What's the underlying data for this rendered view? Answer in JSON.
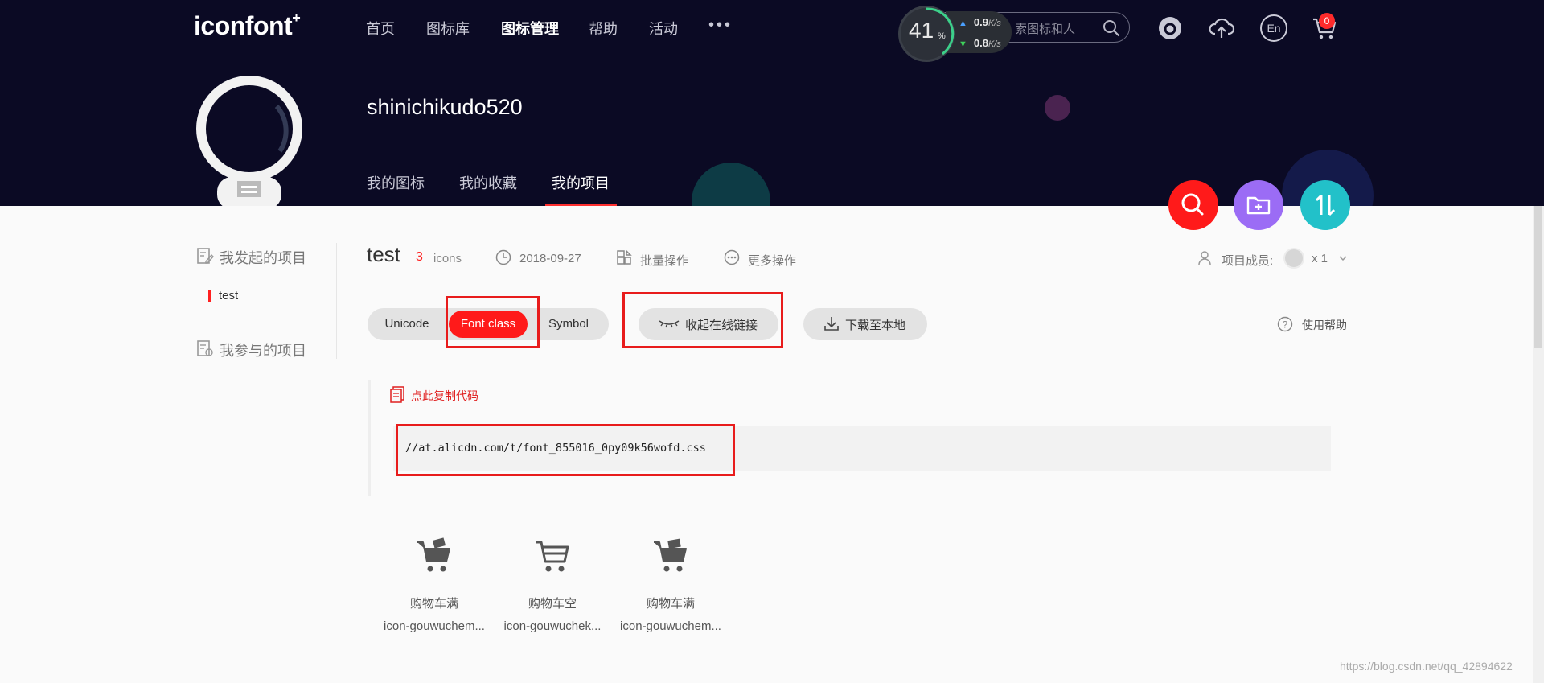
{
  "header": {
    "logo": "iconfont",
    "logo_plus": "+",
    "nav": [
      "首页",
      "图标库",
      "图标管理",
      "帮助",
      "活动"
    ],
    "nav_active_index": 2,
    "more": "•••",
    "search_placeholder": "索图标和人",
    "cart_count": "0",
    "icons": [
      "github-icon",
      "upload-cloud-icon",
      "language-en-icon",
      "cart-icon"
    ],
    "lang_label": "En"
  },
  "speed_widget": {
    "percent": "41",
    "percent_sign": "%",
    "upload": "0.9",
    "download": "0.8",
    "unit": "K/s"
  },
  "profile": {
    "username": "shinichikudo520",
    "tabs": [
      "我的图标",
      "我的收藏",
      "我的项目"
    ],
    "active_tab_index": 2
  },
  "sidebar": {
    "my_projects_title": "我发起的项目",
    "project_item": "test",
    "joined_projects_title": "我参与的项目"
  },
  "project": {
    "name": "test",
    "icon_count": "3",
    "icons_word": "icons",
    "date": "2018-09-27",
    "batch_ops": "批量操作",
    "more_ops": "更多操作",
    "members_label": "项目成员:",
    "members_count": "x 1"
  },
  "toolbar": {
    "segments": [
      "Unicode",
      "Font class",
      "Symbol"
    ],
    "active_segment": "Font class",
    "online_link_label": "收起在线链接",
    "download_label": "下载至本地",
    "help_label": "使用帮助"
  },
  "code": {
    "copy_label": "点此复制代码",
    "url": "//at.alicdn.com/t/font_855016_0py09k56wofd.css"
  },
  "icons": [
    {
      "name": "购物车满",
      "class": "icon-gouwuchem..."
    },
    {
      "name": "购物车空",
      "class": "icon-gouwuchek..."
    },
    {
      "name": "购物车满",
      "class": "icon-gouwuchem..."
    }
  ],
  "watermark": "https://blog.csdn.net/qq_42894622",
  "colors": {
    "header_bg": "#0b0a24",
    "accent_red": "#ff1a1a",
    "fab_red": "#ff1a1a",
    "fab_purple": "#9b6cf5",
    "fab_teal": "#22c1c9"
  }
}
